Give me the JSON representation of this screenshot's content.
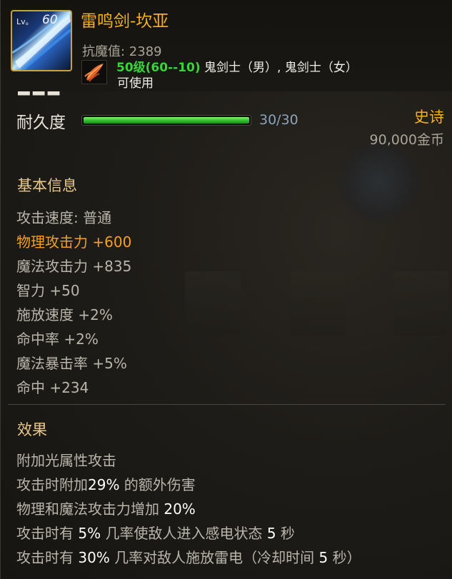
{
  "item": {
    "icon_name": "thunder-sword-icon",
    "level_prefix": "Lv。",
    "level": "60",
    "name": "雷鸣剑-坎亚",
    "anti_magic": "抗魔值: 2389",
    "requirement_level": "50级(60--10)",
    "requirement_classes": " 鬼剑士（男）, 鬼剑士（女）",
    "usable": "可使用",
    "class_icon_name": "feather-class-icon"
  },
  "durability": {
    "label": "耐久度",
    "current": 30,
    "max": 30,
    "text": "30/30",
    "fill_fraction": 1.0
  },
  "rarity": "史诗",
  "price": "90,000金币",
  "basic": {
    "title": "基本信息",
    "stats": [
      {
        "text": "攻击速度: 普通",
        "highlight": false
      },
      {
        "text": "物理攻击力 +600",
        "highlight": true
      },
      {
        "text": "魔法攻击力 +835",
        "highlight": false
      },
      {
        "text": "智力 +50",
        "highlight": false
      },
      {
        "text": "施放速度 +2%",
        "highlight": false
      },
      {
        "text": "命中率 +2%",
        "highlight": false
      },
      {
        "text": "魔法暴击率 +5%",
        "highlight": false
      },
      {
        "text": "命中 +234",
        "highlight": false
      }
    ]
  },
  "effects": {
    "title": "效果",
    "lines": [
      {
        "pre": "附加光属性攻击",
        "hl1": "",
        "mid": "",
        "hl2": "",
        "post": ""
      },
      {
        "pre": "攻击时附加",
        "hl1": "29%",
        "mid": " 的额外伤害",
        "hl2": "",
        "post": ""
      },
      {
        "pre": "物理和魔法攻击力增加 ",
        "hl1": "20%",
        "mid": "",
        "hl2": "",
        "post": ""
      },
      {
        "pre": "攻击时有 ",
        "hl1": "5%",
        "mid": " 几率使敌人进入感电状态 ",
        "hl2": "5",
        "post": " 秒"
      },
      {
        "pre": "攻击时有 ",
        "hl1": "30%",
        "mid": " 几率对敌人施放雷电（冷却时间 ",
        "hl2": "5",
        "post": " 秒）"
      }
    ]
  },
  "colors": {
    "title": "#f5b120",
    "requirement_level": "#39d43a",
    "highlight_stat": "#f5a020",
    "section_title": "#e8c88a",
    "body_text": "#b9b5aa",
    "durability_value": "#8aa3bb"
  }
}
